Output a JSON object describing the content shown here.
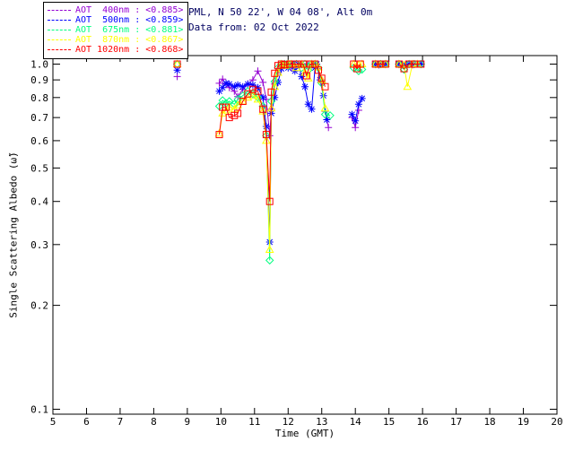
{
  "header": {
    "title": "PML, N 50 22', W 04 08', Alt 0m",
    "subtitle": "Data from: 02 Oct 2022",
    "title_color": "#000060"
  },
  "legend": {
    "entries": [
      {
        "label": "AOT  400nm : <0.885>",
        "color": "#9400D3"
      },
      {
        "label": "AOT  500nm : <0.859>",
        "color": "#0000FF"
      },
      {
        "label": "AOT  675nm : <0.881>",
        "color": "#00FF7F"
      },
      {
        "label": "AOT  870nm : <0.867>",
        "color": "#FFFF00"
      },
      {
        "label": "AOT 1020nm : <0.868>",
        "color": "#FF0000"
      }
    ]
  },
  "chart_data": {
    "type": "line",
    "title": "PML, N 50 22', W 04 08', Alt 0m",
    "subtitle": "Data from: 02 Oct 2022",
    "xlabel": "Time (GMT)",
    "ylabel": "Single Scattering Albedo (ω̃)",
    "xlim": [
      5,
      20
    ],
    "ylim": [
      0.1,
      1.0
    ],
    "yscale": "log",
    "grid": false,
    "legend_position": "top-left",
    "xticks": [
      5,
      6,
      7,
      8,
      9,
      10,
      11,
      12,
      13,
      14,
      15,
      16,
      17,
      18,
      19,
      20
    ],
    "yticks": [
      1.0,
      0.9,
      0.8,
      0.7,
      0.6,
      0.5,
      0.4,
      0.3,
      0.2,
      0.1
    ],
    "series": [
      {
        "name": "AOT 400nm",
        "mean": 0.885,
        "color": "#9400D3",
        "marker": "plus",
        "segments": [
          [
            [
              8.7,
              0.92
            ]
          ],
          [
            [
              9.95,
              0.88
            ],
            [
              10.05,
              0.905
            ],
            [
              10.15,
              0.875
            ],
            [
              10.25,
              0.855
            ],
            [
              10.4,
              0.835
            ],
            [
              10.5,
              0.805
            ],
            [
              10.65,
              0.845
            ],
            [
              10.8,
              0.875
            ],
            [
              10.95,
              0.9
            ],
            [
              11.1,
              0.955
            ],
            [
              11.25,
              0.885
            ],
            [
              11.35,
              0.79
            ],
            [
              11.45,
              0.62
            ],
            [
              11.5,
              0.74
            ],
            [
              11.6,
              0.875
            ],
            [
              11.7,
              0.945
            ],
            [
              11.8,
              1.0
            ],
            [
              11.9,
              0.995
            ],
            [
              12.0,
              1.0
            ],
            [
              12.1,
              0.975
            ],
            [
              12.2,
              1.0
            ],
            [
              12.3,
              0.995
            ],
            [
              12.4,
              1.0
            ],
            [
              12.5,
              0.985
            ],
            [
              12.6,
              1.0
            ],
            [
              12.7,
              0.995
            ],
            [
              12.8,
              1.0
            ],
            [
              12.9,
              0.97
            ],
            [
              13.0,
              0.9
            ],
            [
              13.1,
              0.73
            ],
            [
              13.2,
              0.655
            ]
          ],
          [
            [
              13.9,
              0.7
            ],
            [
              14.0,
              0.655
            ],
            [
              14.1,
              0.735
            ]
          ],
          [
            [
              14.6,
              1.0
            ],
            [
              14.7,
              0.995
            ],
            [
              14.8,
              1.0
            ],
            [
              14.9,
              1.0
            ]
          ],
          [
            [
              15.3,
              1.0
            ],
            [
              15.4,
              0.995
            ],
            [
              15.5,
              1.0
            ],
            [
              15.6,
              1.0
            ],
            [
              15.7,
              0.995
            ],
            [
              15.85,
              1.0
            ],
            [
              15.95,
              1.0
            ]
          ]
        ]
      },
      {
        "name": "AOT 500nm",
        "mean": 0.859,
        "color": "#0000FF",
        "marker": "asterisk",
        "segments": [
          [
            [
              8.7,
              0.96
            ]
          ],
          [
            [
              9.95,
              0.835
            ],
            [
              10.05,
              0.855
            ],
            [
              10.15,
              0.88
            ],
            [
              10.25,
              0.875
            ],
            [
              10.4,
              0.86
            ],
            [
              10.5,
              0.87
            ],
            [
              10.65,
              0.86
            ],
            [
              10.8,
              0.875
            ],
            [
              10.95,
              0.87
            ],
            [
              11.1,
              0.855
            ],
            [
              11.25,
              0.8
            ],
            [
              11.35,
              0.66
            ],
            [
              11.45,
              0.305
            ],
            [
              11.5,
              0.72
            ],
            [
              11.6,
              0.8
            ],
            [
              11.7,
              0.885
            ],
            [
              11.8,
              0.97
            ],
            [
              11.9,
              1.0
            ],
            [
              12.0,
              0.975
            ],
            [
              12.1,
              1.0
            ],
            [
              12.2,
              0.955
            ],
            [
              12.3,
              1.0
            ],
            [
              12.4,
              0.92
            ],
            [
              12.5,
              0.86
            ],
            [
              12.6,
              0.765
            ],
            [
              12.7,
              0.74
            ],
            [
              12.8,
              0.975
            ],
            [
              12.85,
              1.0
            ],
            [
              12.95,
              0.9
            ],
            [
              13.05,
              0.81
            ],
            [
              13.15,
              0.69
            ]
          ],
          [
            [
              13.9,
              0.715
            ],
            [
              14.0,
              0.685
            ],
            [
              14.1,
              0.765
            ],
            [
              14.2,
              0.795
            ]
          ],
          [
            [
              14.6,
              1.0
            ],
            [
              14.7,
              0.995
            ],
            [
              14.8,
              1.0
            ],
            [
              14.9,
              1.0
            ]
          ],
          [
            [
              15.3,
              1.0
            ],
            [
              15.45,
              0.995
            ],
            [
              15.6,
              1.0
            ],
            [
              15.75,
              1.0
            ],
            [
              15.95,
              1.0
            ]
          ]
        ]
      },
      {
        "name": "AOT 675nm",
        "mean": 0.881,
        "color": "#00FF7F",
        "marker": "diamond",
        "segments": [
          [
            [
              8.7,
              1.0
            ]
          ],
          [
            [
              9.95,
              0.755
            ],
            [
              10.05,
              0.785
            ],
            [
              10.15,
              0.77
            ],
            [
              10.25,
              0.78
            ],
            [
              10.4,
              0.765
            ],
            [
              10.5,
              0.79
            ],
            [
              10.65,
              0.81
            ],
            [
              10.8,
              0.835
            ],
            [
              10.95,
              0.82
            ],
            [
              11.1,
              0.8
            ],
            [
              11.25,
              0.755
            ],
            [
              11.35,
              0.62
            ],
            [
              11.45,
              0.27
            ],
            [
              11.5,
              0.78
            ],
            [
              11.6,
              0.89
            ],
            [
              11.7,
              0.975
            ],
            [
              11.8,
              1.0
            ],
            [
              11.9,
              1.0
            ],
            [
              12.0,
              0.99
            ],
            [
              12.1,
              1.0
            ],
            [
              12.25,
              1.0
            ],
            [
              12.4,
              0.975
            ],
            [
              12.5,
              1.0
            ],
            [
              12.6,
              0.96
            ],
            [
              12.7,
              1.0
            ],
            [
              12.8,
              1.0
            ],
            [
              12.9,
              0.975
            ],
            [
              13.0,
              0.88
            ],
            [
              13.1,
              0.715
            ],
            [
              13.25,
              0.71
            ]
          ],
          [
            [
              13.95,
              0.975
            ],
            [
              14.1,
              0.955
            ],
            [
              14.2,
              0.965
            ]
          ],
          [
            [
              14.6,
              1.0
            ],
            [
              14.75,
              1.0
            ],
            [
              14.9,
              1.0
            ]
          ],
          [
            [
              15.3,
              1.0
            ],
            [
              15.45,
              0.965
            ],
            [
              15.6,
              1.0
            ],
            [
              15.75,
              1.0
            ],
            [
              15.95,
              1.0
            ]
          ]
        ]
      },
      {
        "name": "AOT 870nm",
        "mean": 0.867,
        "color": "#FFFF00",
        "marker": "triangle",
        "segments": [
          [
            [
              8.7,
              1.0
            ]
          ],
          [
            [
              9.95,
              0.63
            ],
            [
              10.05,
              0.72
            ],
            [
              10.15,
              0.735
            ],
            [
              10.25,
              0.75
            ],
            [
              10.4,
              0.74
            ],
            [
              10.5,
              0.76
            ],
            [
              10.65,
              0.78
            ],
            [
              10.8,
              0.8
            ],
            [
              10.95,
              0.81
            ],
            [
              11.1,
              0.79
            ],
            [
              11.25,
              0.73
            ],
            [
              11.35,
              0.6
            ],
            [
              11.45,
              0.29
            ],
            [
              11.5,
              0.745
            ],
            [
              11.6,
              0.86
            ],
            [
              11.7,
              0.945
            ],
            [
              11.8,
              1.0
            ],
            [
              11.9,
              0.99
            ],
            [
              12.0,
              1.0
            ],
            [
              12.1,
              1.0
            ],
            [
              12.25,
              0.975
            ],
            [
              12.4,
              1.0
            ],
            [
              12.5,
              0.945
            ],
            [
              12.6,
              0.91
            ],
            [
              12.7,
              1.0
            ],
            [
              12.8,
              1.0
            ],
            [
              12.9,
              0.98
            ],
            [
              13.0,
              0.9
            ],
            [
              13.1,
              0.745
            ]
          ],
          [
            [
              13.95,
              1.0
            ],
            [
              14.1,
              0.995
            ],
            [
              14.2,
              1.0
            ]
          ],
          [
            [
              14.6,
              1.0
            ],
            [
              14.75,
              0.995
            ],
            [
              14.9,
              1.0
            ]
          ],
          [
            [
              15.3,
              1.0
            ],
            [
              15.45,
              0.995
            ],
            [
              15.55,
              0.86
            ],
            [
              15.7,
              1.0
            ],
            [
              15.85,
              1.0
            ]
          ]
        ]
      },
      {
        "name": "AOT 1020nm",
        "mean": 0.868,
        "color": "#FF0000",
        "marker": "square",
        "segments": [
          [
            [
              8.7,
              1.0
            ]
          ],
          [
            [
              9.95,
              0.625
            ],
            [
              10.05,
              0.75
            ],
            [
              10.15,
              0.75
            ],
            [
              10.25,
              0.7
            ],
            [
              10.4,
              0.71
            ],
            [
              10.5,
              0.72
            ],
            [
              10.65,
              0.78
            ],
            [
              10.8,
              0.82
            ],
            [
              10.95,
              0.845
            ],
            [
              11.1,
              0.835
            ],
            [
              11.25,
              0.74
            ],
            [
              11.35,
              0.625
            ],
            [
              11.45,
              0.4
            ],
            [
              11.5,
              0.83
            ],
            [
              11.6,
              0.94
            ],
            [
              11.7,
              0.99
            ],
            [
              11.8,
              1.0
            ],
            [
              11.9,
              0.995
            ],
            [
              12.05,
              1.0
            ],
            [
              12.2,
              1.0
            ],
            [
              12.3,
              1.0
            ],
            [
              12.45,
              1.0
            ],
            [
              12.55,
              0.925
            ],
            [
              12.65,
              1.0
            ],
            [
              12.8,
              1.0
            ],
            [
              12.9,
              0.96
            ],
            [
              13.0,
              0.91
            ],
            [
              13.1,
              0.86
            ]
          ],
          [
            [
              13.95,
              1.0
            ],
            [
              14.05,
              0.97
            ],
            [
              14.15,
              1.0
            ]
          ],
          [
            [
              14.6,
              1.0
            ],
            [
              14.75,
              1.0
            ],
            [
              14.9,
              1.0
            ]
          ],
          [
            [
              15.3,
              1.0
            ],
            [
              15.45,
              0.97
            ],
            [
              15.6,
              1.0
            ],
            [
              15.75,
              1.0
            ],
            [
              15.95,
              1.0
            ]
          ]
        ]
      }
    ]
  }
}
